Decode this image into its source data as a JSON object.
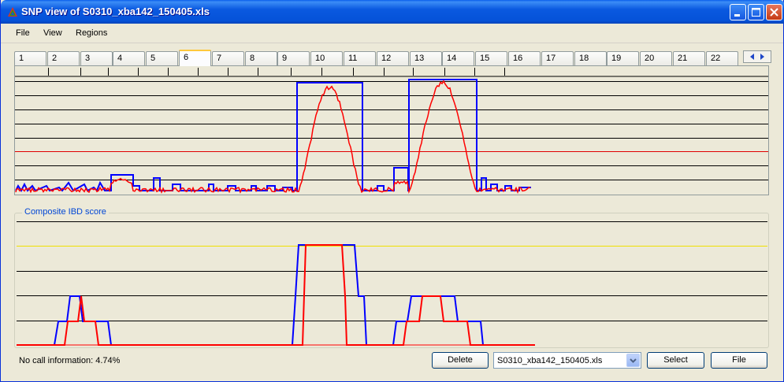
{
  "window": {
    "title": "SNP view of S0310_xba142_150405.xls",
    "controls": [
      "minimize",
      "maximize",
      "close"
    ]
  },
  "menu": {
    "items": [
      {
        "label": "File"
      },
      {
        "label": "View"
      },
      {
        "label": "Regions"
      }
    ]
  },
  "tabs": {
    "items": [
      "1",
      "2",
      "3",
      "4",
      "5",
      "6",
      "7",
      "8",
      "9",
      "10",
      "11",
      "12",
      "13",
      "14",
      "15",
      "16",
      "17",
      "18",
      "19",
      "20",
      "21",
      "22"
    ],
    "active": "6",
    "scroll_icons": [
      "arrow-left-icon",
      "arrow-right-icon"
    ]
  },
  "snp_plot": {
    "gridline_count": 8,
    "threshold_color": "#E00000",
    "series_colors": {
      "blue": "#0000FF",
      "red": "#FF0000"
    },
    "region_markers": 15
  },
  "ibd": {
    "caption": "Composite IBD score",
    "threshold_color": "#F0E000"
  },
  "status": {
    "no_call": "No call information: 4.74%"
  },
  "buttons": {
    "delete": "Delete",
    "select": "Select",
    "file": "File"
  },
  "file_select": {
    "value": "S0310_xba142_150405.xls"
  },
  "colors": {
    "title_bar": "#0A5EEB",
    "active_tab_accent": "#FFC83C",
    "caption": "#0046D5"
  }
}
